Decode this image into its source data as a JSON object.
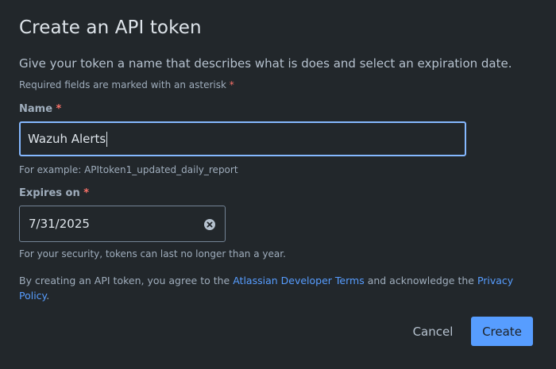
{
  "dialog": {
    "title": "Create an API token",
    "description": "Give your token a name that describes what is does and select an expiration date.",
    "required_note": "Required fields are marked with an asterisk",
    "asterisk": "*"
  },
  "name_field": {
    "label": "Name",
    "value": "Wazuh Alerts",
    "helper": "For example: APItoken1_updated_daily_report"
  },
  "expires_field": {
    "label": "Expires on",
    "value": "7/31/2025",
    "helper": "For your security, tokens can last no longer than a year.",
    "clear_icon": "clear-circle-x-icon"
  },
  "terms": {
    "prefix": "By creating an API token, you agree to the ",
    "link1": "Atlassian Developer Terms",
    "middle": " and acknowledge the ",
    "link2": "Privacy Policy",
    "suffix": "."
  },
  "actions": {
    "cancel_label": "Cancel",
    "create_label": "Create"
  },
  "colors": {
    "background": "#22272b",
    "accent": "#579dff",
    "focus_border": "#85b8ff",
    "required": "#f87168"
  }
}
